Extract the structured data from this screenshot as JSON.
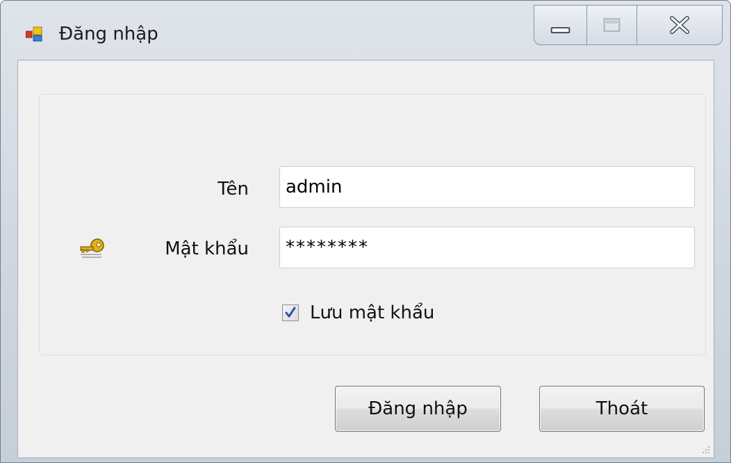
{
  "window": {
    "title": "Đăng nhập",
    "icon": "form-window-icon",
    "controls": {
      "minimize": "minimize-icon",
      "maximize": "maximize-icon",
      "close": "close-icon"
    }
  },
  "form": {
    "name_label": "Tên",
    "name_value": "admin",
    "password_label": "Mật khẩu",
    "password_value": "********",
    "key_icon": "key-icon",
    "remember_label": "Lưu mật khẩu",
    "remember_checked": true
  },
  "buttons": {
    "login_label": "Đăng nhập",
    "exit_label": "Thoát"
  },
  "colors": {
    "check_mark": "#2a52be",
    "key_gold": "#e0b21a"
  }
}
